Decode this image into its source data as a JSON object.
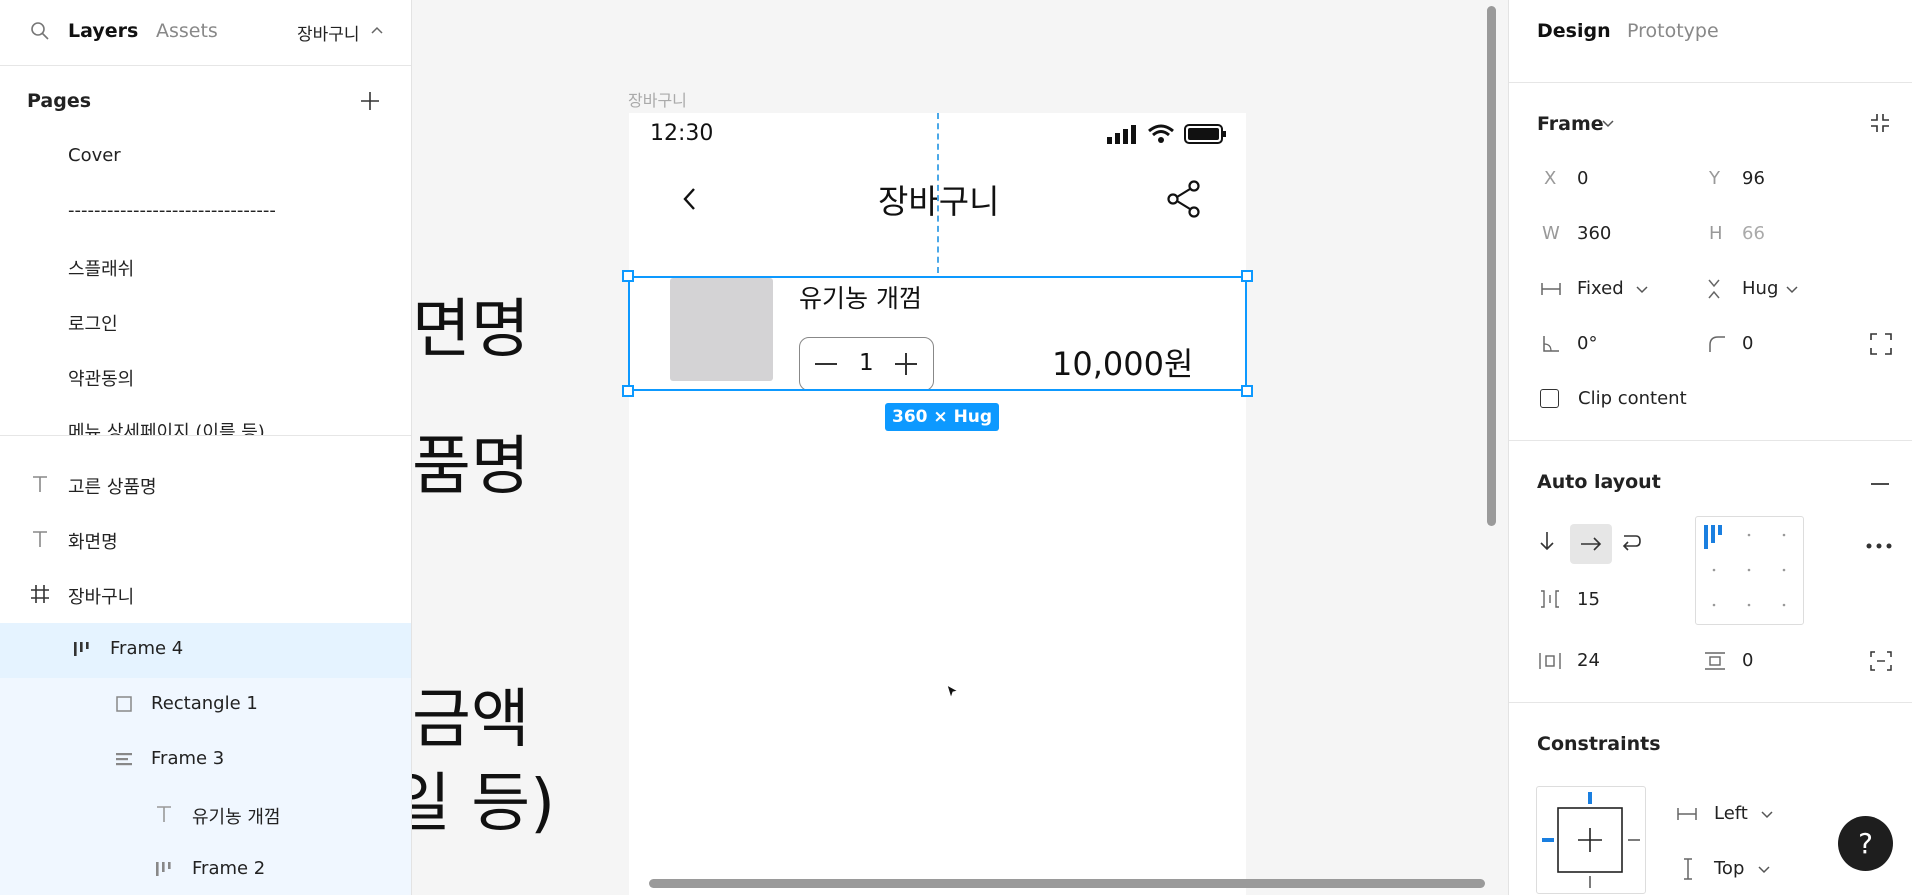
{
  "left_panel": {
    "tabs": {
      "layers": "Layers",
      "assets": "Assets",
      "page_selector": "장바구니"
    },
    "pages": {
      "title": "Pages",
      "items": [
        "Cover",
        "--------------------------------",
        "스플래쉬",
        "로그인",
        "약관동의",
        "메뉴 상세페이지 (이름 등)"
      ]
    },
    "layers": [
      {
        "label": "고른 상품명",
        "icon": "text-icon"
      },
      {
        "label": "화면명",
        "icon": "text-icon"
      },
      {
        "label": "장바구니",
        "icon": "frame-grid-icon"
      },
      {
        "label": "Frame 4",
        "icon": "auto-layout-horizontal-icon"
      },
      {
        "label": "Rectangle 1",
        "icon": "rectangle-icon"
      },
      {
        "label": "Frame 3",
        "icon": "auto-layout-vertical-icon"
      },
      {
        "label": "유기농 개껌",
        "icon": "text-icon"
      },
      {
        "label": "Frame 2",
        "icon": "auto-layout-horizontal-icon"
      }
    ]
  },
  "canvas": {
    "frame_label": "장바구니",
    "bg_texts": [
      "면명",
      "품명",
      "금액",
      "일 등)"
    ],
    "phone": {
      "time": "12:30",
      "title": "장바구니",
      "item_name": "유기농 개껌",
      "quantity": "1",
      "price": "10,000원"
    },
    "size_badge": "360 × Hug"
  },
  "right_panel": {
    "tabs": {
      "design": "Design",
      "prototype": "Prototype"
    },
    "frame": {
      "title": "Frame",
      "x_label": "X",
      "x": "0",
      "y_label": "Y",
      "y": "96",
      "w_label": "W",
      "w": "360",
      "h_label": "H",
      "h": "66",
      "width_mode": "Fixed",
      "height_mode": "Hug",
      "rotation": "0°",
      "radius": "0",
      "clip_content": "Clip content"
    },
    "auto_layout": {
      "title": "Auto layout",
      "gap": "15",
      "padding_h": "24",
      "padding_v": "0"
    },
    "constraints": {
      "title": "Constraints",
      "horizontal": "Left",
      "vertical": "Top"
    },
    "help": "?"
  },
  "colors": {
    "selection": "#0d99ff",
    "selected_row": "#e5f3ff",
    "child_row": "#f0f7ff"
  }
}
